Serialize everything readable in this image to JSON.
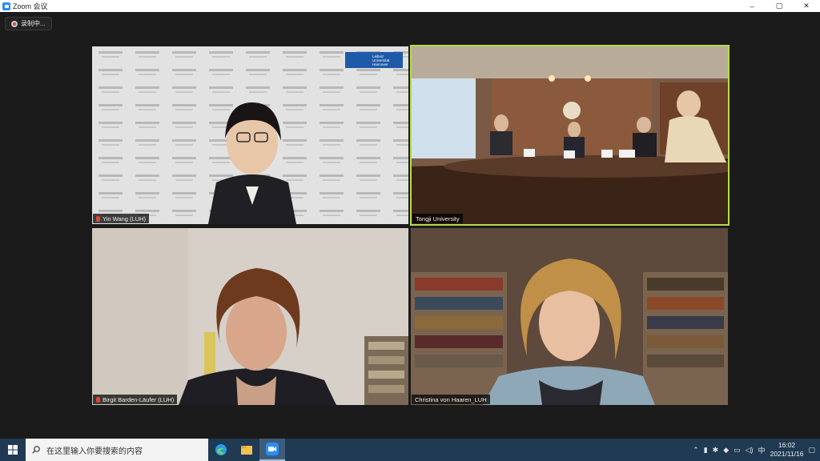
{
  "window": {
    "title": "Zoom 会议",
    "controls": [
      "–",
      "▢",
      "✕"
    ]
  },
  "recording": {
    "label": "录制中..."
  },
  "participants": [
    {
      "name": "Yin Wang (LUH)",
      "muted": true,
      "logo_text": [
        "Leibniz",
        "Universität",
        "Hannover"
      ]
    },
    {
      "name": "Tongji University",
      "muted": false,
      "active_speaker": true
    },
    {
      "name": "Birgit Barden-Läufer (LUH)",
      "muted": true
    },
    {
      "name": "Christina von Haaren_LUH",
      "muted": false
    }
  ],
  "taskbar": {
    "search_placeholder": "在这里输入你要搜索的内容",
    "apps": [
      "edge-icon",
      "file-explorer-icon",
      "zoom-icon"
    ],
    "tray": {
      "ime": "中",
      "time": "16:02",
      "date": "2021/11/16"
    }
  },
  "colors": {
    "active_speaker_border": "#b9d94c",
    "taskbar": "#1f3a52",
    "zoom_blue": "#2d8cff",
    "muted_red": "#e0453a"
  }
}
